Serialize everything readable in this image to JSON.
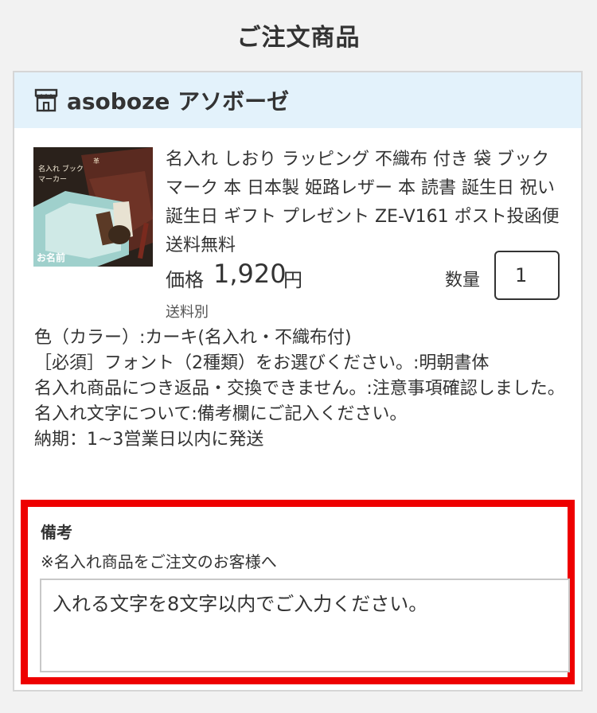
{
  "page": {
    "title": "ご注文商品"
  },
  "shop": {
    "name": "asoboze アソボーゼ",
    "icon": "store-icon"
  },
  "product": {
    "name": "名入れ しおり ラッピング 不織布 付き 袋 ブックマーク 本 日本製 姫路レザー 本 読書 誕生日 祝い 誕生日 ギフト プレゼント ZE-V161 ポスト投函便送料無料",
    "image_caption": "お名前",
    "image_label": "名入れ ブックマーカー",
    "price_label": "価格",
    "price_value": "1,920",
    "price_unit": "円",
    "shipping_label": "送料別",
    "quantity_label": "数量",
    "quantity_value": "1"
  },
  "options": [
    "色（カラー）:カーキ(名入れ・不織布付)",
    "［必須］フォント（2種類）をお選びください。:明朝書体",
    "名入れ商品につき返品・交換できません。:注意事項確認しました。",
    "名入れ文字について:備考欄にご記入ください。",
    "納期：1~3営業日以内に発送"
  ],
  "notes": {
    "title": "備考",
    "subtitle": "※名入れ商品をご注文のお客様へ",
    "placeholder": "入れる文字を8文字以内でご入力ください。"
  },
  "colors": {
    "header_bg": "#e3f2fb",
    "highlight": "#ee0000"
  }
}
